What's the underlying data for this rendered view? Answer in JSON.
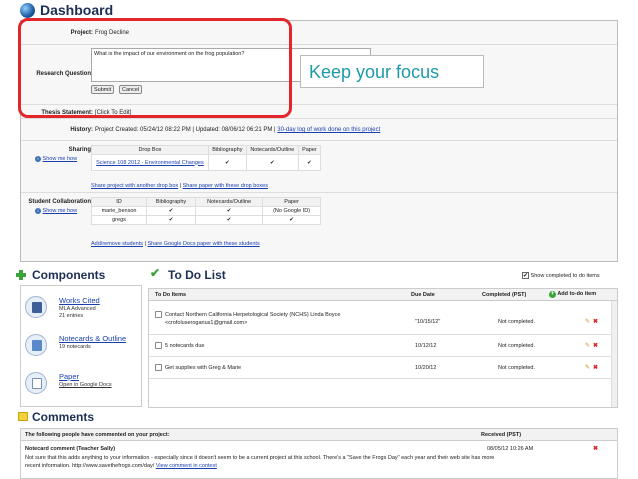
{
  "header": {
    "title": "Dashboard",
    "icon": "globe-icon"
  },
  "project": {
    "project_label": "Project:",
    "project_value": "Frog Decline",
    "question_label": "Research Question:",
    "question_value": "What is the impact of our environment on the frog population?",
    "submit_label": "Submit",
    "cancel_label": "Cancel",
    "thesis_label": "Thesis Statement:",
    "thesis_value": "[Click To Edit]",
    "history_label": "History:",
    "history_text": "Project Created: 05/24/12 08:22 PM | Updated: 08/06/12 06:21 PM |",
    "history_link": "30-day log of work done on this project",
    "sharing_label": "Sharing:",
    "show_me_how": "Show me how",
    "sharing_table": {
      "headers": [
        "Drop Box",
        "Bibliography",
        "Notecards/Outline",
        "Paper"
      ],
      "rows": [
        {
          "name": "Science 108 2012 - Environmental Changes",
          "checks": [
            "✔",
            "✔",
            "✔"
          ]
        }
      ]
    },
    "share_link_a": "Share project with another drop box",
    "share_link_b": "Share paper with these drop boxes",
    "collab_label": "Student Collaboration:",
    "collab_table": {
      "headers": [
        "ID",
        "Bibliography",
        "Notecards/Outline",
        "Paper"
      ],
      "rows": [
        {
          "id": "marie_benson",
          "bib": "✔",
          "notes": "✔",
          "paper": "(No Google ID)"
        },
        {
          "id": "gregs",
          "bib": "✔",
          "notes": "✔",
          "paper": "✔"
        }
      ]
    },
    "collab_link_a": "Add/remove students",
    "collab_link_b": "Share Google Docs paper with these students"
  },
  "overlay": {
    "focus_text": "Keep your focus",
    "accent": "#e2262b"
  },
  "components": {
    "title": "Components",
    "items": [
      {
        "name": "Works Cited",
        "sub1": "MLA Advanced",
        "sub2": "21 entries"
      },
      {
        "name": "Notecards & Outline",
        "sub1": "19 notecards"
      },
      {
        "name": "Paper",
        "sub1": "Open in Google Docs"
      }
    ]
  },
  "todo": {
    "title": "To Do List",
    "show_completed": "Show completed to do items",
    "columns": {
      "item": "To Do Items",
      "due": "Due Date",
      "completed": "Completed (PST)",
      "add": "Add to-do item"
    },
    "rows": [
      {
        "item": "Contact Northern California Herpetological Society (NCHS) Linda Boyce <crofoluseroganus1@gmail.com>",
        "due": "\"10/15/12\"",
        "status": "Not completed."
      },
      {
        "item": "5 notecards due",
        "due": "10/12/12",
        "status": "Not completed."
      },
      {
        "item": "Get supplies with Greg & Marie",
        "due": "10/20/12",
        "status": "Not completed."
      }
    ]
  },
  "comments": {
    "title": "Comments",
    "header_text": "The following people have commented on your project:",
    "received_label": "Received (PST)",
    "entries": [
      {
        "author": "Notecard comment (Teacher Sally)",
        "received": "08/05/12 10:26 AM",
        "text": "Not sure that this adds anything to your information - especially since it doesn't seem to be a current project at this school. There's a \"Save the Frogs Day\" each year and their web site has more recent information. http://www.savethefrogs.com/day/",
        "link": "View comment in context"
      }
    ]
  }
}
